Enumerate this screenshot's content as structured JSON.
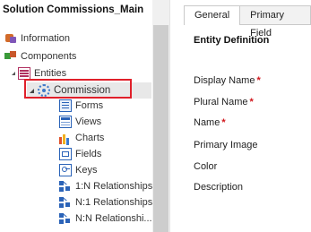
{
  "solution_title": "Solution Commissions_Main",
  "tree": {
    "information": "Information",
    "components": "Components",
    "entities": "Entities",
    "commission": "Commission",
    "children": [
      {
        "label": "Forms",
        "icon": "form-icon"
      },
      {
        "label": "Views",
        "icon": "views-icon"
      },
      {
        "label": "Charts",
        "icon": "chart-icon"
      },
      {
        "label": "Fields",
        "icon": "field-icon"
      },
      {
        "label": "Keys",
        "icon": "key-icon"
      },
      {
        "label": "1:N Relationships",
        "icon": "relationship-icon"
      },
      {
        "label": "N:1 Relationships",
        "icon": "relationship-icon"
      },
      {
        "label": "N:N Relationshi...",
        "icon": "relationship-icon"
      }
    ]
  },
  "tabs": [
    "General",
    "Primary Field"
  ],
  "entity_definition": {
    "heading": "Entity Definition",
    "fields": [
      {
        "label": "Display Name",
        "required": true
      },
      {
        "label": "Plural Name",
        "required": true
      },
      {
        "label": "Name",
        "required": true
      },
      {
        "label": "Primary Image",
        "required": false
      },
      {
        "label": "Color",
        "required": false
      },
      {
        "label": "Description",
        "required": false
      }
    ],
    "required_marker": "*"
  },
  "colors": {
    "selection_highlight": "#e0202a",
    "required": "#d1151b"
  }
}
